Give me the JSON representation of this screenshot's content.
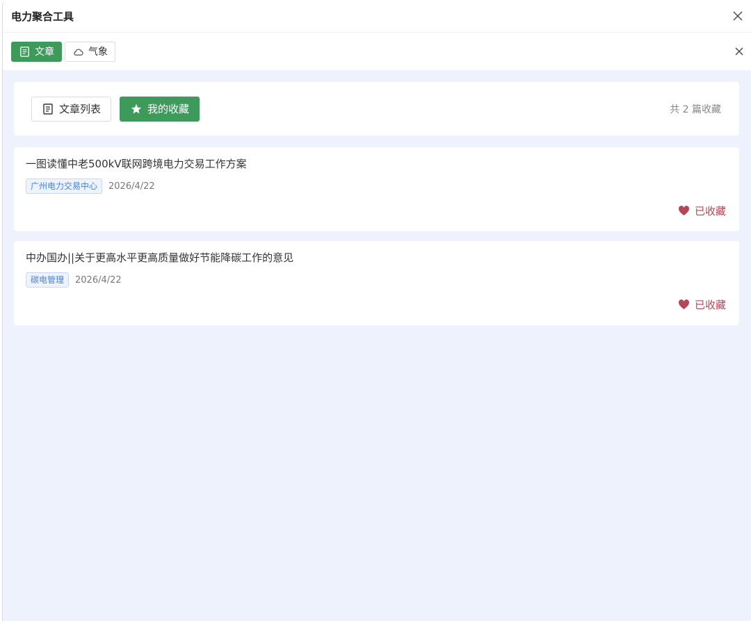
{
  "window": {
    "title": "电力聚合工具"
  },
  "tabs": [
    {
      "label": "文章",
      "icon": "document-icon",
      "active": true
    },
    {
      "label": "气象",
      "icon": "cloud-icon",
      "active": false
    }
  ],
  "toolbar": {
    "list_label": "文章列表",
    "favorites_label": "我的收藏",
    "count_text": "共 2 篇收藏"
  },
  "articles": [
    {
      "title": "一图读懂中老500kV联网跨境电力交易工作方案",
      "tag": "广州电力交易中心",
      "date": "2026/4/22",
      "fav_label": "已收藏"
    },
    {
      "title": "中办国办||关于更高水平更高质量做好节能降碳工作的意见",
      "tag": "碳电管理",
      "date": "2026/4/22",
      "fav_label": "已收藏"
    }
  ],
  "colors": {
    "primary_green": "#3d9a5b",
    "favorite_red": "#b24855",
    "tag_blue": "#4a7fd8",
    "content_bg": "#eef2fc"
  }
}
